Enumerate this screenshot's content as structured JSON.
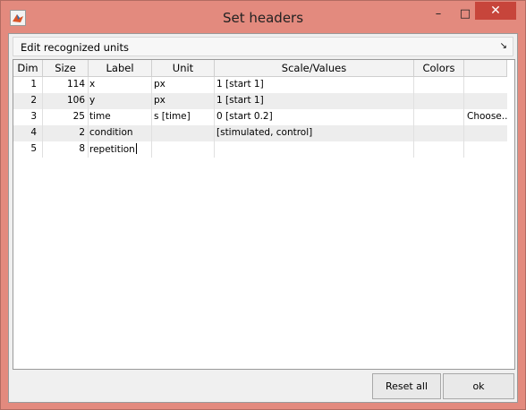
{
  "window": {
    "title": "Set headers",
    "minimize_glyph": "–",
    "maximize_glyph": "□",
    "close_glyph": "✕",
    "icon": "matlab-icon"
  },
  "panel": {
    "label": "Edit recognized units",
    "toggle_glyph": "↘"
  },
  "table": {
    "columns": [
      "Dim",
      "Size",
      "Label",
      "Unit",
      "Scale/Values",
      "Colors",
      ""
    ],
    "rows": [
      {
        "dim": "1",
        "size": "114",
        "label": "x",
        "unit": "px",
        "scale": "1 [start 1]",
        "colors": "",
        "extra": ""
      },
      {
        "dim": "2",
        "size": "106",
        "label": "y",
        "unit": "px",
        "scale": "1 [start 1]",
        "colors": "",
        "extra": ""
      },
      {
        "dim": "3",
        "size": "25",
        "label": "time",
        "unit": "s [time]",
        "scale": "0 [start 0.2]",
        "colors": "",
        "extra": "Choose..."
      },
      {
        "dim": "4",
        "size": "2",
        "label": "condition",
        "unit": "",
        "scale": "[stimulated, control]",
        "colors": "",
        "extra": ""
      },
      {
        "dim": "5",
        "size": "8",
        "label": "repetition",
        "unit": "",
        "scale": "",
        "colors": "",
        "extra": ""
      }
    ]
  },
  "buttons": {
    "reset": "Reset all",
    "ok": "ok"
  }
}
